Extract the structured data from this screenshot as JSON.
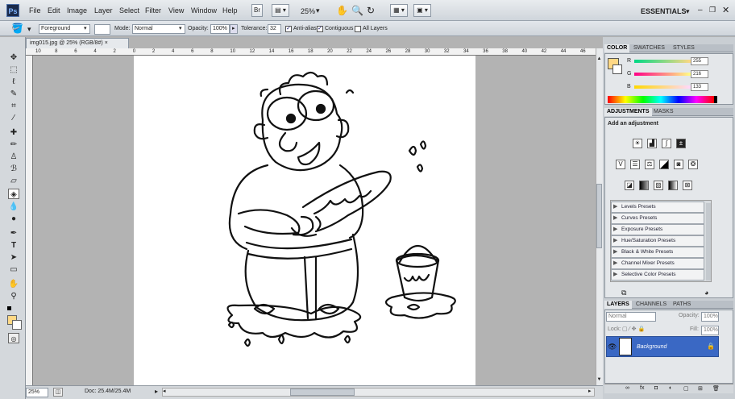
{
  "app": {
    "logo": "Ps"
  },
  "menu": [
    "File",
    "Edit",
    "Image",
    "Layer",
    "Select",
    "Filter",
    "View",
    "Window",
    "Help"
  ],
  "appbar": {
    "bridge": "Br",
    "zoom": "25%",
    "workspace": "ESSENTIALS"
  },
  "options": {
    "fill_source": "Foreground",
    "mode_label": "Mode:",
    "mode": "Normal",
    "opacity_label": "Opacity:",
    "opacity": "100%",
    "tolerance_label": "Tolerance:",
    "tolerance": "32",
    "antialias": "Anti-alias",
    "contiguous": "Contiguous",
    "all_layers": "All Layers"
  },
  "document": {
    "tab": "img015.jpg @ 25% (RGB/8#)",
    "close": "×",
    "status_zoom": "25%",
    "status_doc": "Doc: 25.4M/25.4M",
    "ruler_ticks": [
      "10",
      "8",
      "6",
      "4",
      "2",
      "0",
      "2",
      "4",
      "6",
      "8",
      "10",
      "12",
      "14",
      "16",
      "18",
      "20",
      "22",
      "24",
      "26",
      "28",
      "30",
      "32",
      "34",
      "36",
      "38",
      "40",
      "42",
      "44",
      "46"
    ]
  },
  "color_panel": {
    "tabs": [
      "COLOR",
      "SWATCHES",
      "STYLES"
    ],
    "r_label": "R",
    "g_label": "G",
    "b_label": "B",
    "r": "255",
    "g": "216",
    "b": "133",
    "foreground": "#ffd885"
  },
  "adjustments": {
    "tabs": [
      "ADJUSTMENTS",
      "MASKS"
    ],
    "heading": "Add an adjustment",
    "presets": [
      "Levels Presets",
      "Curves Presets",
      "Exposure Presets",
      "Hue/Saturation Presets",
      "Black & White Presets",
      "Channel Mixer Presets",
      "Selective Color Presets"
    ]
  },
  "layers": {
    "tabs": [
      "LAYERS",
      "CHANNELS",
      "PATHS"
    ],
    "blend": "Normal",
    "opacity_label": "Opacity:",
    "opacity": "100%",
    "lock_label": "Lock:",
    "fill_label": "Fill:",
    "fill": "100%",
    "layer_name": "Background",
    "footer_icons": [
      "∞",
      "fx",
      "◘",
      "◐",
      "▢",
      "⊞",
      "🗑"
    ]
  }
}
